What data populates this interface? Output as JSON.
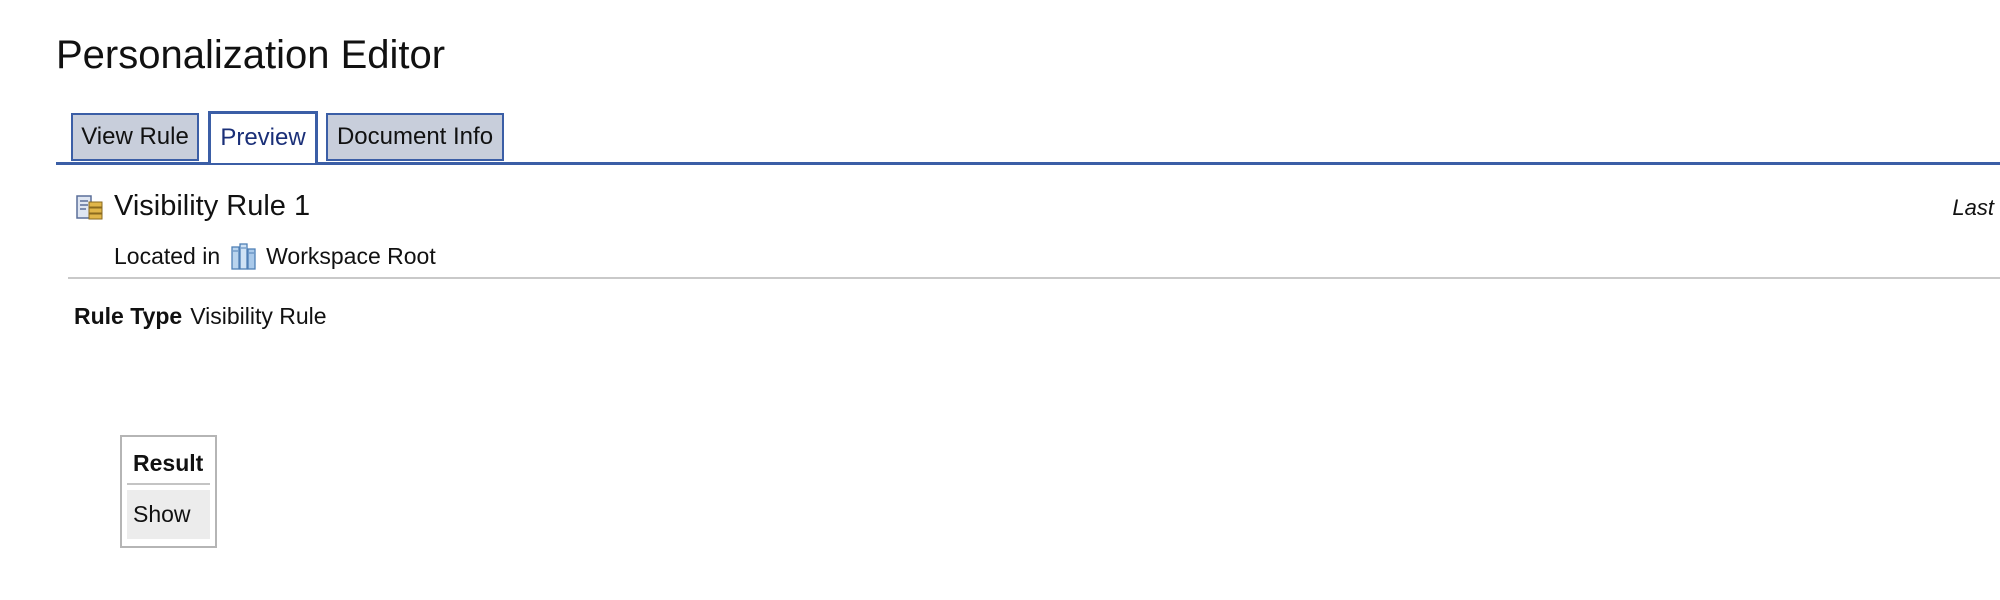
{
  "page": {
    "title": "Personalization Editor"
  },
  "tabs": [
    {
      "label": "View Rule",
      "active": false
    },
    {
      "label": "Preview",
      "active": true
    },
    {
      "label": "Document Info",
      "active": false
    }
  ],
  "document": {
    "name": "Visibility Rule 1",
    "icon": "rule-document-icon",
    "last_label": "Last",
    "located_label": "Located in",
    "location_icon": "workspace-books-icon",
    "location_name": "Workspace Root"
  },
  "properties": {
    "rule_type_label": "Rule Type",
    "rule_type_value": "Visibility Rule"
  },
  "result_table": {
    "header": "Result",
    "value": "Show"
  },
  "colors": {
    "accent": "#3b5ea6",
    "tab_inactive_bg": "#c8cedb",
    "active_tab_text": "#1a2f78",
    "divider": "#c9c9c9",
    "result_cell_bg": "#ececec"
  }
}
